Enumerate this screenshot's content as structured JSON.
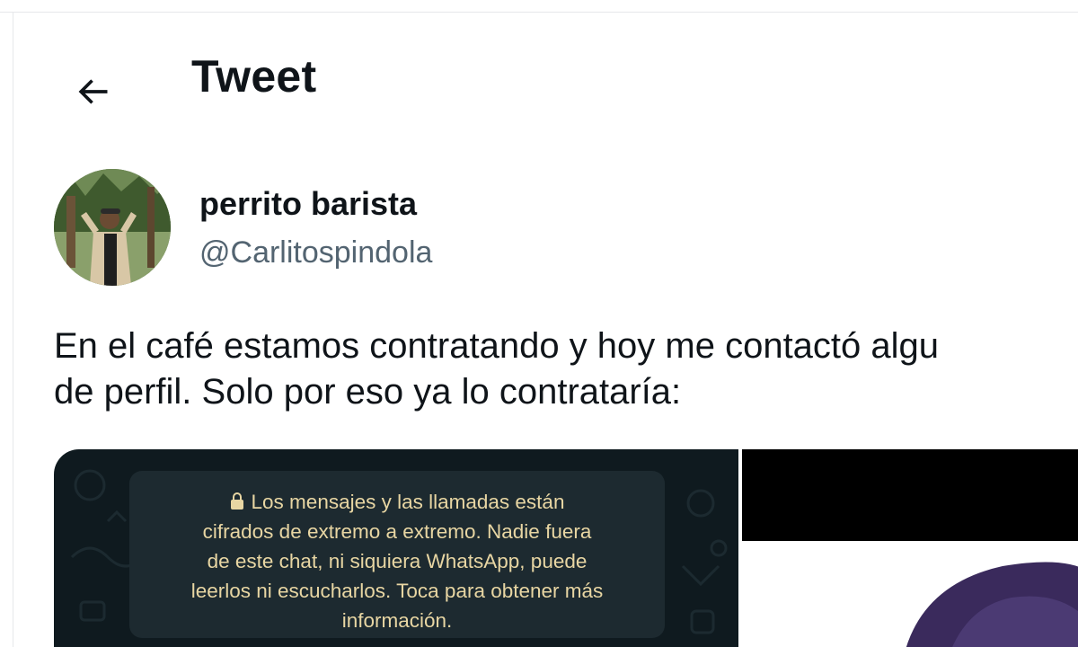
{
  "header": {
    "title": "Tweet"
  },
  "tweet": {
    "author": {
      "display_name": "perrito barista",
      "handle": "@Carlitospindola"
    },
    "text_line1": "En el café estamos contratando y hoy me contactó algu",
    "text_line2": "de perfil. Solo por eso ya lo contrataría:",
    "media": {
      "whatsapp_notice": {
        "line1": "Los mensajes y las llamadas están",
        "line2": "cifrados de extremo a extremo. Nadie fuera",
        "line3": "de este chat, ni siquiera WhatsApp, puede",
        "line4": "leerlos ni escucharlos. Toca para obtener más",
        "line5": "información."
      }
    }
  },
  "colors": {
    "text_primary": "#0f1419",
    "text_secondary": "#536471",
    "whatsapp_bg": "#0f1a1f",
    "whatsapp_banner": "#1d2a30",
    "whatsapp_banner_text": "#e8d6a3"
  },
  "icons": {
    "back": "back-arrow-icon",
    "lock": "lock-icon"
  }
}
